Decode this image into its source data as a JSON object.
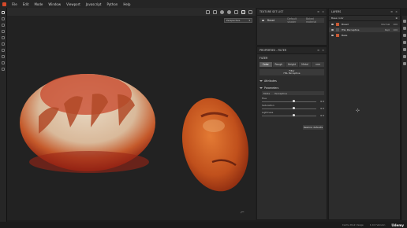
{
  "menu": [
    "File",
    "Edit",
    "Mode",
    "Window",
    "Viewport",
    "Javascript",
    "Python",
    "Help"
  ],
  "viewport": {
    "camera": "Perspective"
  },
  "texture_set_list": {
    "title": "TEXTURE SET LIST",
    "item_name": "Bread",
    "item_shader": "Default shader",
    "item_material": "Baked material"
  },
  "properties": {
    "title": "PROPERTIES - FILTER",
    "filter_label": "FILTER",
    "tabs": [
      "Color",
      "Rough",
      "Height",
      "Metal",
      "nrm"
    ],
    "filter_box_title": "Filter",
    "filter_box_name": "HSL Perceptive",
    "attributes": "Attributes",
    "parameters": "Parameters",
    "mode_label": "Mode",
    "mode_value": "Perceptive",
    "hue": {
      "label": "Hue",
      "value": "0.5",
      "level": 0.5
    },
    "saturation": {
      "label": "Saturation",
      "value": "0.5",
      "level": 0.5
    },
    "lightness": {
      "label": "Lightness",
      "value": "0.5",
      "level": 0.5
    },
    "restore": "Restore defaults"
  },
  "layers": {
    "title": "LAYERS",
    "blend_mode": "Base color",
    "rows": [
      {
        "name": "Bread",
        "blend": "Normal",
        "opacity": "100"
      },
      {
        "name": "HSL Perceptive",
        "blend": "Repl",
        "opacity": "100"
      },
      {
        "name": "Bake",
        "blend": "",
        "opacity": ""
      }
    ]
  },
  "status": {
    "cache": "Cache Disk Usage",
    "version": "1.0.0 Version",
    "brand": "Udemy"
  },
  "colors": {
    "accent": "#d84a2a",
    "bread_crust": "#c8561f",
    "bread_light": "#e3d3bd"
  }
}
